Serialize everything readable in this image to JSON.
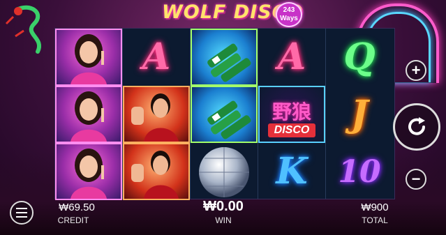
{
  "game": {
    "title": "WOLF DISCO",
    "ways_number": "243",
    "ways_word": "Ways"
  },
  "reels": [
    [
      {
        "kind": "character-woman",
        "label": ""
      },
      {
        "kind": "character-woman",
        "label": ""
      },
      {
        "kind": "character-woman",
        "label": ""
      }
    ],
    [
      {
        "kind": "letter",
        "label": "A",
        "tone": "pink"
      },
      {
        "kind": "character-man",
        "label": ""
      },
      {
        "kind": "character-man",
        "label": ""
      }
    ],
    [
      {
        "kind": "bottles",
        "label": ""
      },
      {
        "kind": "bottles",
        "label": ""
      },
      {
        "kind": "disco-ball",
        "label": ""
      }
    ],
    [
      {
        "kind": "letter",
        "label": "A",
        "tone": "pink"
      },
      {
        "kind": "wild",
        "label_cn": "野狼",
        "label_en": "DISCO"
      },
      {
        "kind": "letter",
        "label": "K",
        "tone": "blue"
      }
    ],
    [
      {
        "kind": "letter",
        "label": "Q",
        "tone": "green"
      },
      {
        "kind": "letter",
        "label": "J",
        "tone": "orange"
      },
      {
        "kind": "letter",
        "label": "10",
        "tone": "purple"
      }
    ]
  ],
  "controls": {
    "plus": "+",
    "minus": "−",
    "spin_icon": "refresh-icon",
    "menu_icon": "menu-icon"
  },
  "footer": {
    "credit_value": "₩69.50",
    "credit_label": "CREDIT",
    "win_value": "₩0.00",
    "win_label": "WIN",
    "total_value": "₩900",
    "total_label": "TOTAL"
  },
  "colors": {
    "neon_pink": "#ff6aa8",
    "neon_green": "#6cff8a",
    "neon_orange": "#ffb03a",
    "neon_blue": "#4fc0ff",
    "neon_purple": "#c66cff"
  }
}
